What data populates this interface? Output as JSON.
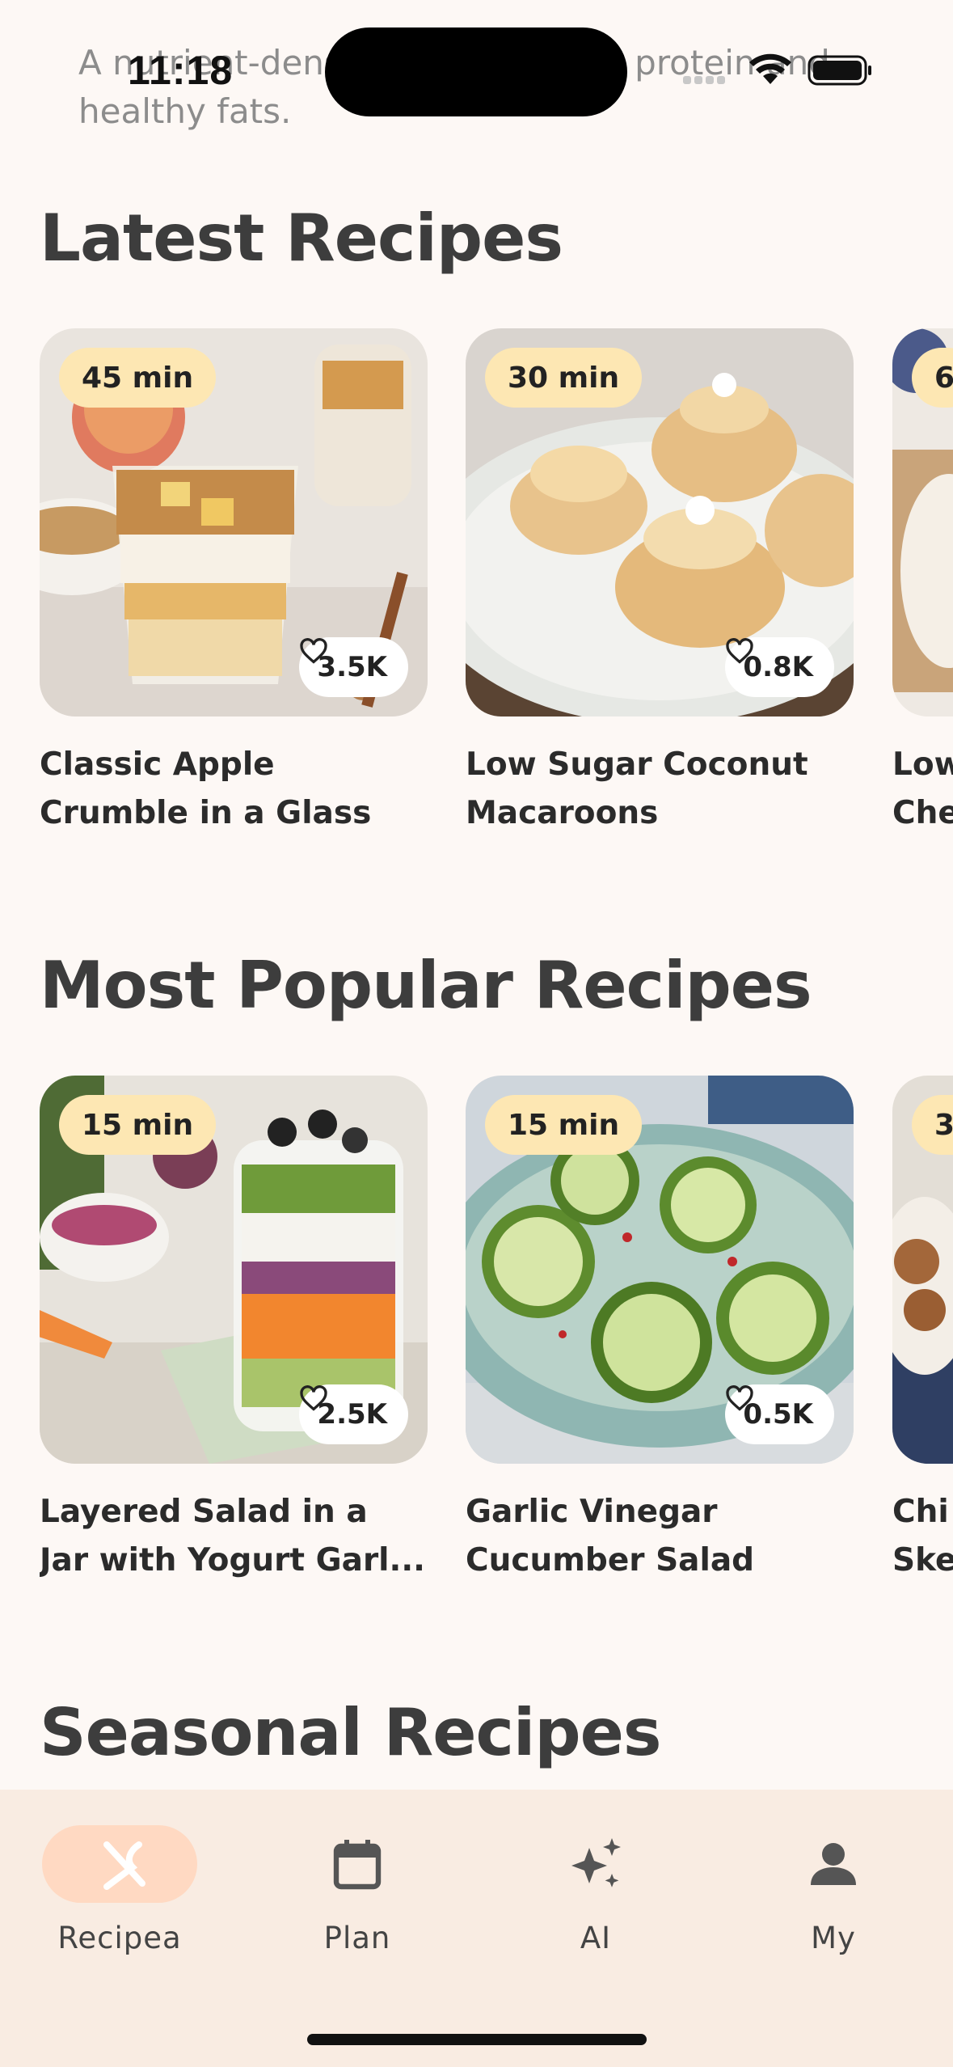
{
  "status_bar": {
    "time": "11:18"
  },
  "intro_text": "A nutrient-dense meal with lean protein and healthy fats.",
  "sections": [
    {
      "title": "Latest Recipes",
      "cards": [
        {
          "time": "45 min",
          "likes": "3.5K",
          "title_line1": "Classic Apple",
          "title_line2": "Crumble in a Glass"
        },
        {
          "time": "30 min",
          "likes": "0.8K",
          "title_line1": "Low Sugar Coconut",
          "title_line2": "Macaroons"
        },
        {
          "time": "6",
          "likes": "",
          "title_line1": "Low",
          "title_line2": "Che"
        }
      ]
    },
    {
      "title": "Most Popular Recipes",
      "cards": [
        {
          "time": "15 min",
          "likes": "2.5K",
          "title_line1": "Layered Salad in a",
          "title_line2": "Jar with Yogurt Garl..."
        },
        {
          "time": "15 min",
          "likes": "0.5K",
          "title_line1": "Garlic Vinegar",
          "title_line2": "Cucumber Salad"
        },
        {
          "time": "3(",
          "likes": "",
          "title_line1": "Chi",
          "title_line2": "Ske"
        }
      ]
    },
    {
      "title": "Seasonal Recipes",
      "cards": []
    }
  ],
  "bottom_nav": {
    "items": [
      {
        "label": "Recipea",
        "icon": "fork-knife-icon",
        "active": true
      },
      {
        "label": "Plan",
        "icon": "calendar-icon",
        "active": false
      },
      {
        "label": "AI",
        "icon": "sparkle-icon",
        "active": false
      },
      {
        "label": "My",
        "icon": "person-icon",
        "active": false
      }
    ],
    "active_pill_color": "#ffd9c2"
  }
}
